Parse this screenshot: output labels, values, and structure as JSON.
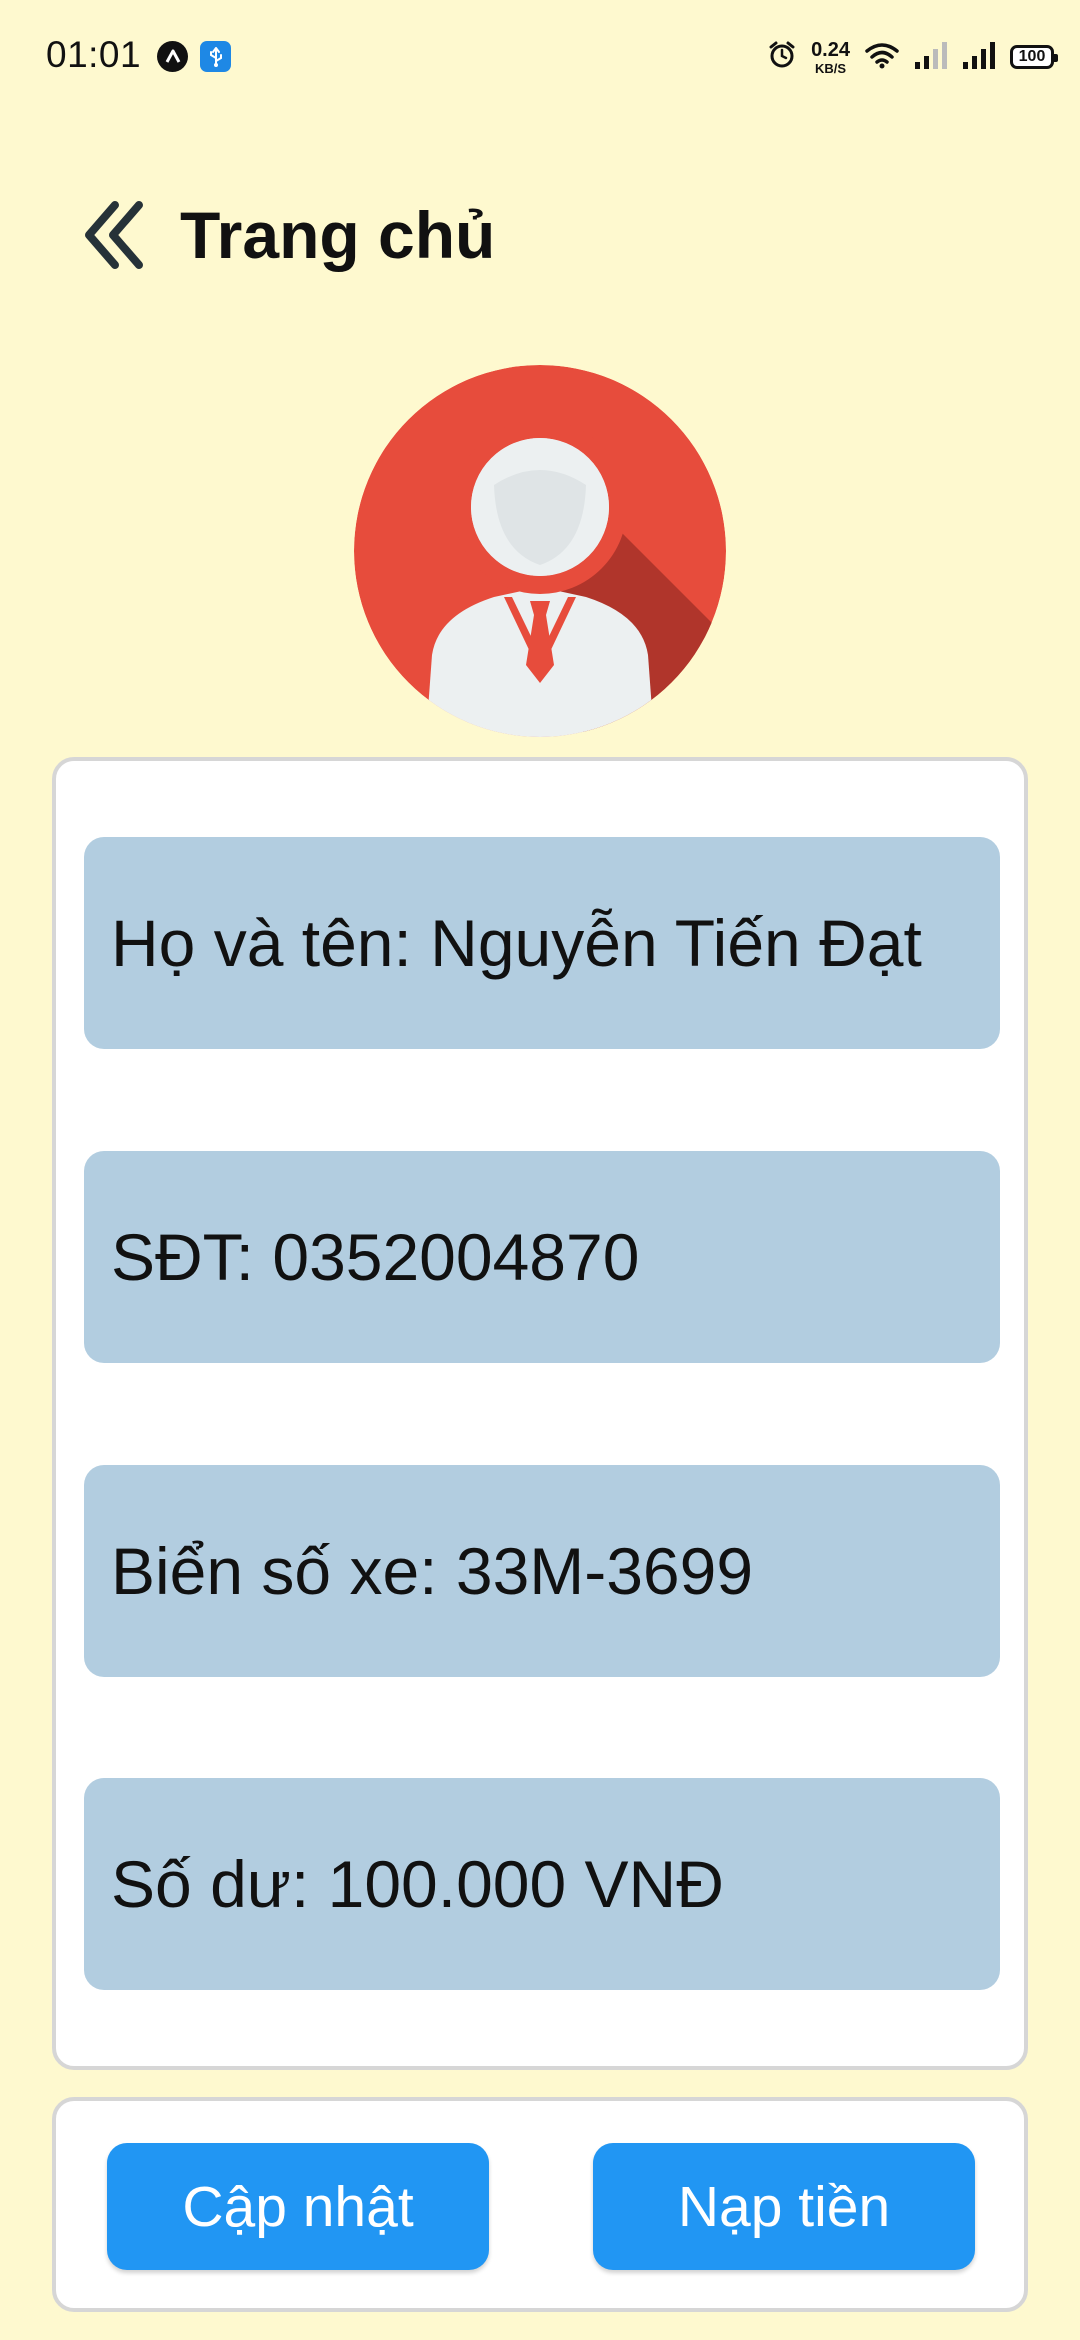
{
  "status_bar": {
    "time": "01:01",
    "net_speed_value": "0.24",
    "net_speed_unit": "KB/S",
    "battery": "100",
    "icons": [
      "app-notification-icon",
      "usb-icon",
      "alarm-icon",
      "wifi-icon",
      "signal-weak-icon",
      "signal-icon",
      "battery-icon"
    ]
  },
  "header": {
    "title": "Trang chủ",
    "back_icon": "double-chevron-left-icon"
  },
  "avatar": {
    "icon": "user-avatar-icon",
    "colors": {
      "circle": "#e74c3c",
      "shadow": "#b0352b",
      "figure": "#ecf0f1"
    }
  },
  "profile": {
    "name_field": "Họ và tên: Nguyễn Tiến Đạt",
    "phone_field": "SĐT: 0352004870",
    "plate_field": "Biển số xe: 33M-3699",
    "balance_field": "Số dư: 100.000 VNĐ"
  },
  "actions": {
    "update_label": "Cập nhật",
    "topup_label": "Nạp tiền"
  },
  "colors": {
    "background": "#fef9cf",
    "card": "#ffffff",
    "row": "#b2cde0",
    "button": "#2196f3"
  }
}
